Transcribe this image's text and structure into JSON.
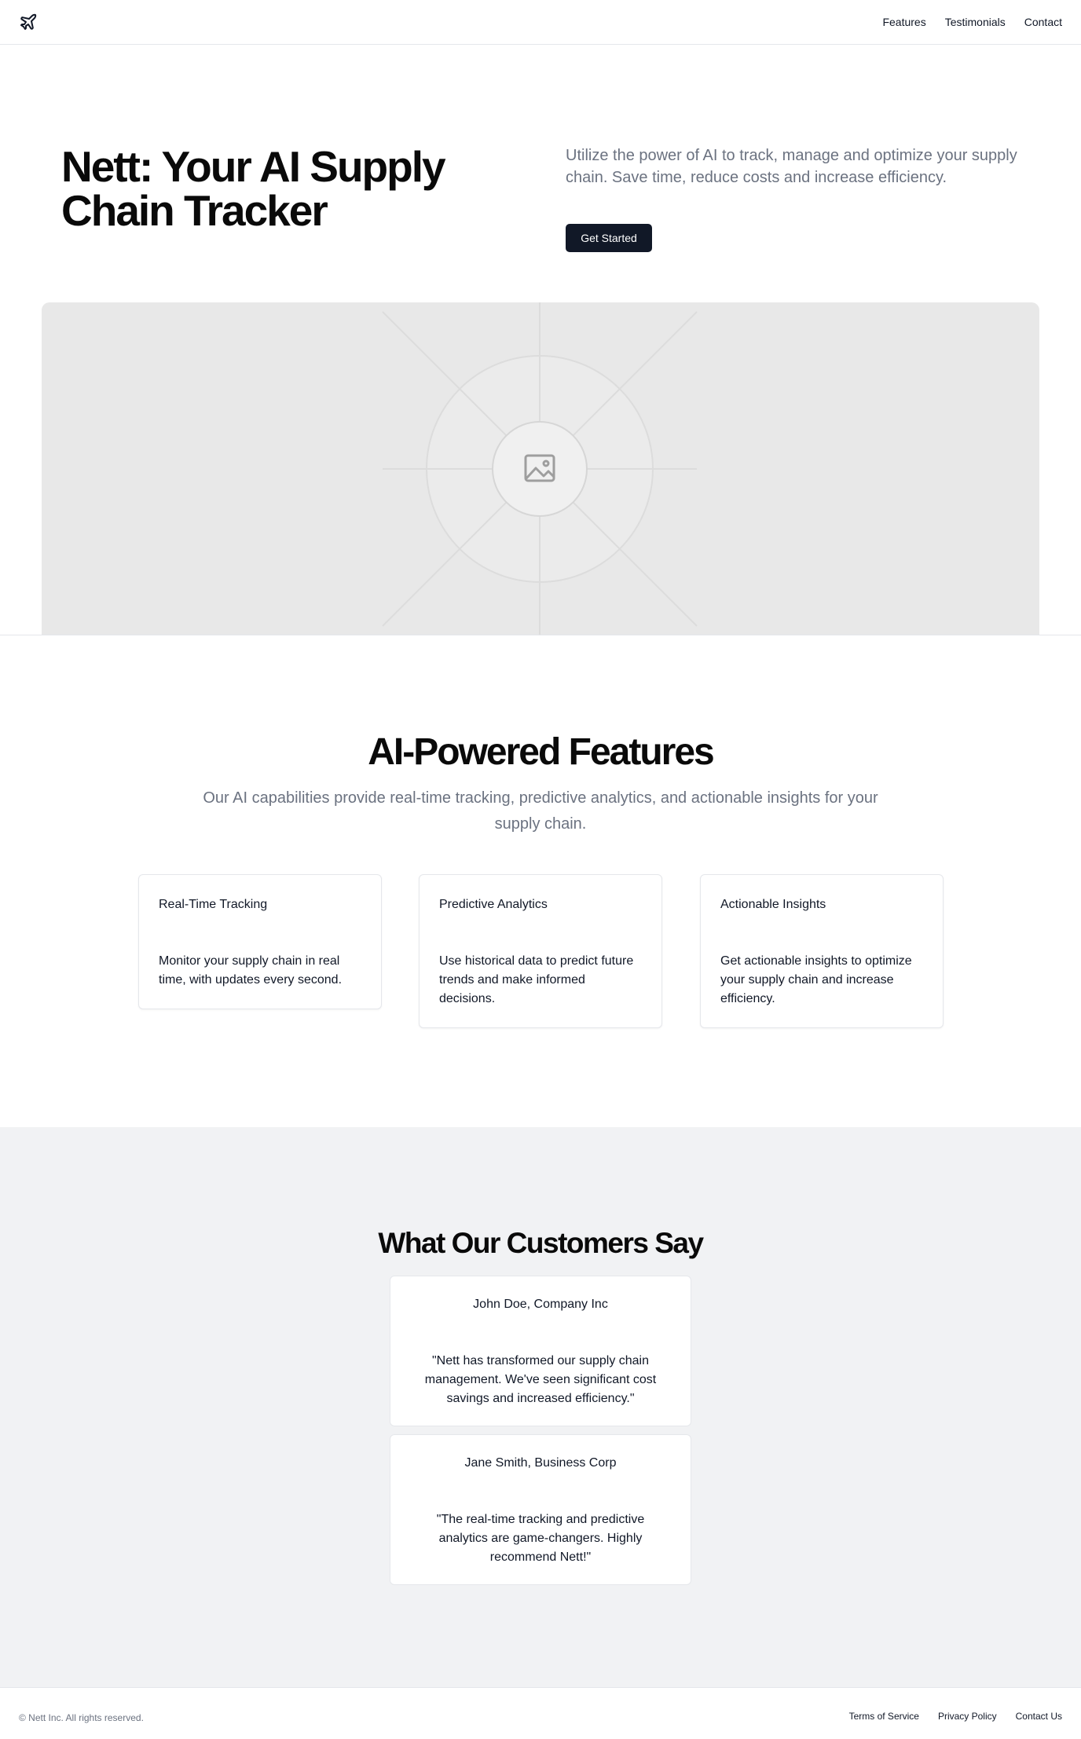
{
  "nav": {
    "logo_icon": "plane-icon",
    "links": [
      "Features",
      "Testimonials",
      "Contact"
    ]
  },
  "hero": {
    "title": "Nett: Your AI Supply Chain Tracker",
    "subtitle": "Utilize the power of AI to track, manage and optimize your supply chain. Save time, reduce costs and increase efficiency.",
    "cta_label": "Get Started",
    "image_icon": "image-placeholder-icon"
  },
  "features": {
    "title": "AI-Powered Features",
    "subtitle": "Our AI capabilities provide real-time tracking, predictive analytics, and actionable insights for your supply chain.",
    "cards": [
      {
        "title": "Real-Time Tracking",
        "description": "Monitor your supply chain in real time, with updates every second."
      },
      {
        "title": "Predictive Analytics",
        "description": "Use historical data to predict future trends and make informed decisions."
      },
      {
        "title": "Actionable Insights",
        "description": "Get actionable insights to optimize your supply chain and increase efficiency."
      }
    ]
  },
  "testimonials": {
    "title": "What Our Customers Say",
    "items": [
      {
        "name": "John Doe, Company Inc",
        "quote": "\"Nett has transformed our supply chain management. We've seen significant cost savings and increased efficiency.\""
      },
      {
        "name": "Jane Smith, Business Corp",
        "quote": "\"The real-time tracking and predictive analytics are game-changers. Highly recommend Nett!\""
      }
    ]
  },
  "footer": {
    "copyright": "© Nett Inc. All rights reserved.",
    "links": [
      "Terms of Service",
      "Privacy Policy",
      "Contact Us"
    ]
  },
  "colors": {
    "primary_button": "#111827",
    "muted_text": "#6b7280",
    "testimonials_bg": "#f1f2f4"
  }
}
